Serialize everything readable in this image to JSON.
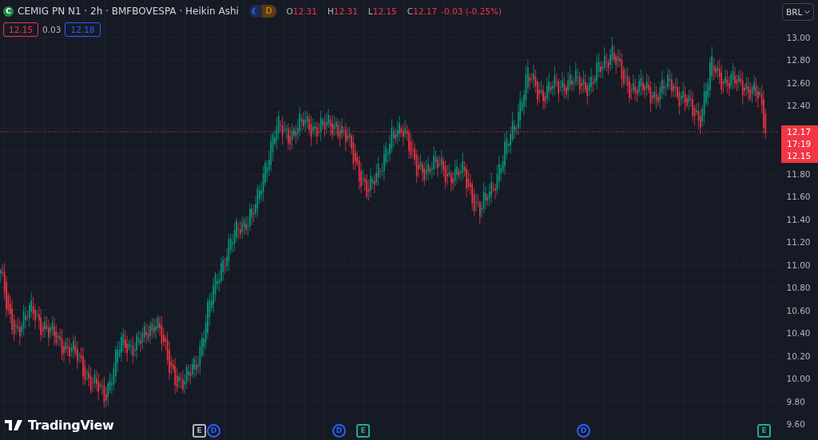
{
  "legend": {
    "logo_letter": "C",
    "title": "CEMIG PN N1 · 2h · BMFBOVESPA · Heikin Ashi",
    "session_badge": "D",
    "ohlc": [
      {
        "label": "O",
        "value": "12.31"
      },
      {
        "label": "H",
        "value": "12.31"
      },
      {
        "label": "L",
        "value": "12.15"
      },
      {
        "label": "C",
        "value": "12.17"
      }
    ],
    "change": "-0.03 (-0.25%)"
  },
  "quote": {
    "bid": "12.15",
    "spread": "0.03",
    "ask": "12.18"
  },
  "currency": "BRL",
  "price_axis": [
    "13.00",
    "12.80",
    "12.60",
    "12.40",
    "11.80",
    "11.60",
    "11.40",
    "11.20",
    "11.00",
    "10.80",
    "10.60",
    "10.40",
    "10.20",
    "10.00",
    "9.80",
    "9.60"
  ],
  "price_tag": [
    "12.17",
    "17:19",
    "12.15"
  ],
  "events": [
    {
      "label": "E",
      "kind": "earnings",
      "color": "#b2b5be"
    },
    {
      "label": "D",
      "kind": "dividend",
      "color": "#2962ff"
    },
    {
      "label": "D",
      "kind": "dividend",
      "color": "#2962ff"
    },
    {
      "label": "E",
      "kind": "earnings",
      "color": "#22ab94"
    },
    {
      "label": "D",
      "kind": "dividend",
      "color": "#2962ff"
    },
    {
      "label": "E",
      "kind": "earnings",
      "color": "#22ab94"
    }
  ],
  "branding": "TradingView"
}
